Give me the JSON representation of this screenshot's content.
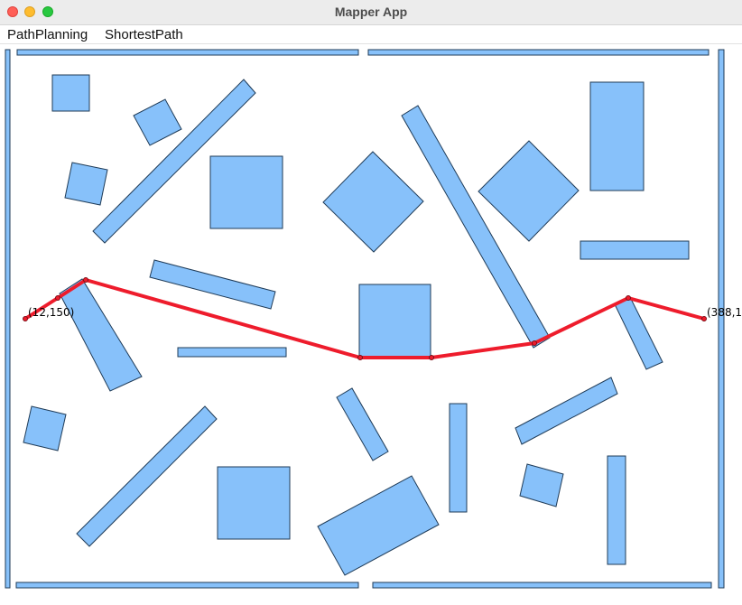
{
  "window": {
    "title": "Mapper App",
    "controls": [
      "close",
      "minimize",
      "maximize"
    ]
  },
  "menubar": {
    "items": [
      "PathPlanning",
      "ShortestPath"
    ]
  },
  "map": {
    "obstacle_color": "#87c1fa",
    "path_color": "#ee1c2c",
    "start_label": "(12,150)",
    "end_label": "(388,1"
  }
}
